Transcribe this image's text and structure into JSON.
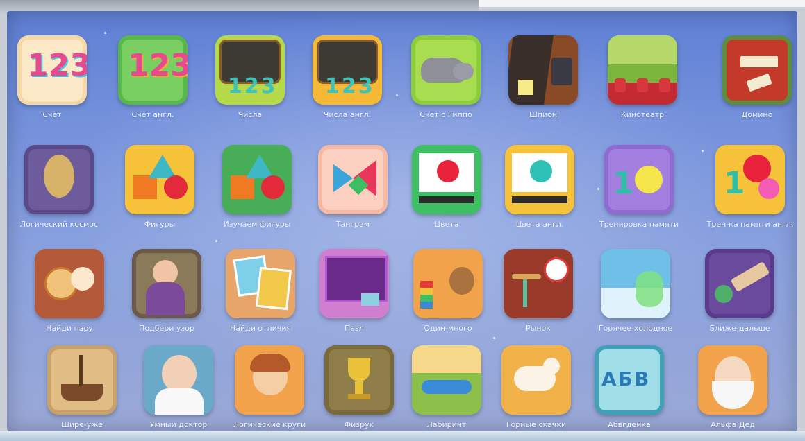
{
  "apps": {
    "row1": [
      {
        "label": "Счёт"
      },
      {
        "label": "Счёт англ."
      },
      {
        "label": "Числа"
      },
      {
        "label": "Числа англ."
      },
      {
        "label": "Счёт с Гиппо"
      },
      {
        "label": "Шпион"
      },
      {
        "label": "Кинотеатр"
      },
      {
        "label": "Домино"
      }
    ],
    "row2": [
      {
        "label": "Логический космос"
      },
      {
        "label": "Фигуры"
      },
      {
        "label": "Изучаем фигуры"
      },
      {
        "label": "Танграм"
      },
      {
        "label": "Цвета"
      },
      {
        "label": "Цвета англ."
      },
      {
        "label": "Тренировка памяти"
      },
      {
        "label": "Трен-ка памяти англ."
      }
    ],
    "row3": [
      {
        "label": "Найди пару"
      },
      {
        "label": "Подбери узор"
      },
      {
        "label": "Найди отличия"
      },
      {
        "label": "Пазл"
      },
      {
        "label": "Один-много"
      },
      {
        "label": "Рынок"
      },
      {
        "label": "Горячее-холодное"
      },
      {
        "label": "Ближе-дальше"
      }
    ],
    "row4": [
      {
        "label": "Шире-уже"
      },
      {
        "label": "Умный доктор"
      },
      {
        "label": "Логические круги"
      },
      {
        "label": "Физрук"
      },
      {
        "label": "Лабиринт"
      },
      {
        "label": "Горные скачки"
      },
      {
        "label": "Абвгдейка"
      },
      {
        "label": "Альфа Дед"
      }
    ]
  },
  "tile_text": {
    "numbers": "123",
    "abv": "АБВ"
  }
}
